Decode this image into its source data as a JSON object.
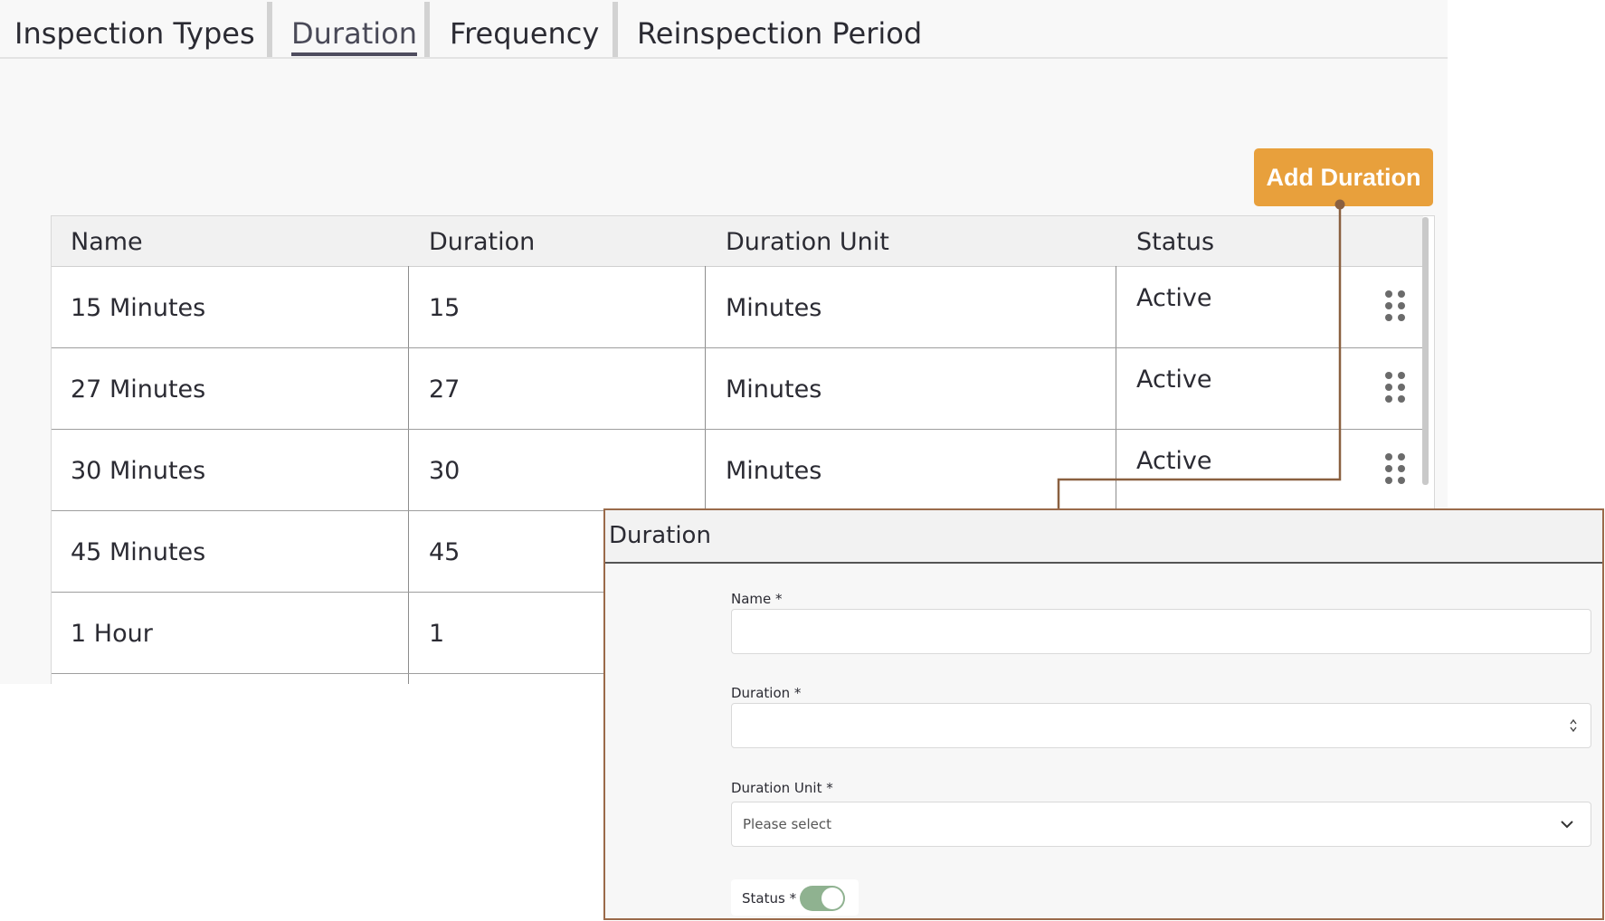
{
  "tabs": [
    {
      "label": "Inspection Types",
      "active": false
    },
    {
      "label": "Duration",
      "active": true
    },
    {
      "label": "Frequency",
      "active": false
    },
    {
      "label": "Reinspection Period",
      "active": false
    }
  ],
  "add_button_label": "Add Duration",
  "table": {
    "headers": [
      "Name",
      "Duration",
      "Duration Unit",
      "Status"
    ],
    "rows": [
      {
        "name": "15 Minutes",
        "duration": "15",
        "unit": "Minutes",
        "status": "Active"
      },
      {
        "name": "27 Minutes",
        "duration": "27",
        "unit": "Minutes",
        "status": "Active"
      },
      {
        "name": "30 Minutes",
        "duration": "30",
        "unit": "Minutes",
        "status": "Active"
      },
      {
        "name": "45 Minutes",
        "duration": "45",
        "unit": "",
        "status": ""
      },
      {
        "name": "1 Hour",
        "duration": "1",
        "unit": "",
        "status": ""
      }
    ]
  },
  "dialog": {
    "title": "Duration",
    "name_label": "Name *",
    "name_value": "",
    "duration_label": "Duration *",
    "duration_value": "",
    "unit_label": "Duration Unit *",
    "unit_placeholder": "Please select",
    "status_label": "Status *",
    "status_on": true
  },
  "colors": {
    "accent_button": "#e8a03c",
    "connector": "#8a6040",
    "toggle_on": "#8fb290"
  },
  "icons": {
    "row_action": "drag-handle-icon",
    "number_stepper": "spinner-arrows-icon",
    "select_arrow": "chevron-down-icon"
  }
}
